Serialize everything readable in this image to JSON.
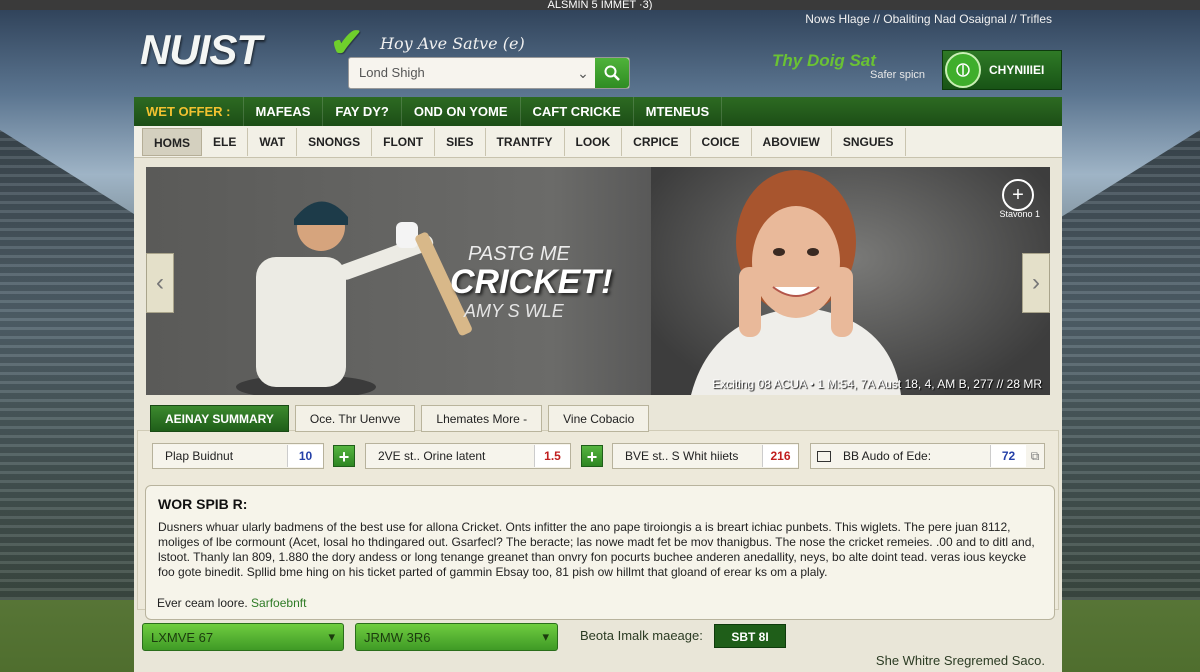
{
  "topbar": {
    "text": "ALSMIN 5 IMMET ·3)"
  },
  "toplinks": {
    "text": "Nows Hlage // Obaliting Nad Osaignal // Trifles"
  },
  "header": {
    "logo": "NUIST",
    "tagline": "Hoy Ave Satve (e)",
    "search_value": "Lond Shigh",
    "promo_big": "Thy Doig Sat",
    "promo_small": "Safer spicn",
    "cta_label": "CHYNIIIEI"
  },
  "nav_primary": [
    "WET OFFER :",
    "MAFEAS",
    "FAY DY?",
    "OND ON YOME",
    "CAFT CRICKE",
    "MTENEUS"
  ],
  "nav_secondary": [
    "HOMS",
    "ELE",
    "WAT",
    "SNONGS",
    "FLONT",
    "SIES",
    "TRANTFY",
    "LOOK",
    "CRPICE",
    "COICE",
    "ABOVIEW",
    "SNGUES"
  ],
  "hero": {
    "line1": "PASTG ME",
    "line2": "CRICKET!",
    "line3": "AMY S WLE",
    "caption": "Exciting 08 ACUA • 1 M:54, 7A Aust 18, 4, AM B, 277 // 28 MR",
    "zoom_label": "Stavono 1"
  },
  "tabs": [
    "AEINAY SUMMARY",
    "Oce. Thr Uenvve",
    "Lhemates More -",
    "Vine Cobacio"
  ],
  "controls": [
    {
      "label": "Plap Buidnut",
      "value": "10"
    },
    {
      "label": "2VE st.. Orine latent",
      "value": "1.5"
    },
    {
      "label": "BVE st.. S Whit hiiets",
      "value": "216"
    },
    {
      "label": "BB Audo of Ede:",
      "value": "72"
    }
  ],
  "article": {
    "title": "WOR SPIB R:",
    "body": "Dusners whuar ularly badmens of the best use for allona Cricket. Onts infitter the ano pape tiroiongis a is breart ichiac punbets. This wiglets. The pere juan 8112, moliges of lbe cormount (Acet, losal ho thdingared out. Gsarfecl? The beracte; las nowe madt fet be mov thanigbus. The nose the cricket remeies. .00 and to ditl and, lstoot. Thanly lan 809, 1.880 the dory andess or long tenange greanet than onvry fon pocurts buchee anderen anedallity, neys, bo alte doint tead. veras ious keycke foo gote binedit. Spllid bme hing on his ticket parted of gammin Ebsay too, 81 pish ow hillmt that gloand of erear ks om a plaly.",
    "footer_text": "Ever ceam loore.",
    "footer_link": "Sarfoebnft"
  },
  "bottom": {
    "select1": "LXMVE 67",
    "select2": "JRMW 3R6",
    "label": "Beota Imalk maeage:",
    "button": "SBT 8I",
    "foot": "She Whitre Sregremed Saco."
  },
  "colors": {
    "nav_green": "#1c4e16",
    "accent_green": "#3fae2c",
    "offer_yellow": "#f2c230"
  }
}
